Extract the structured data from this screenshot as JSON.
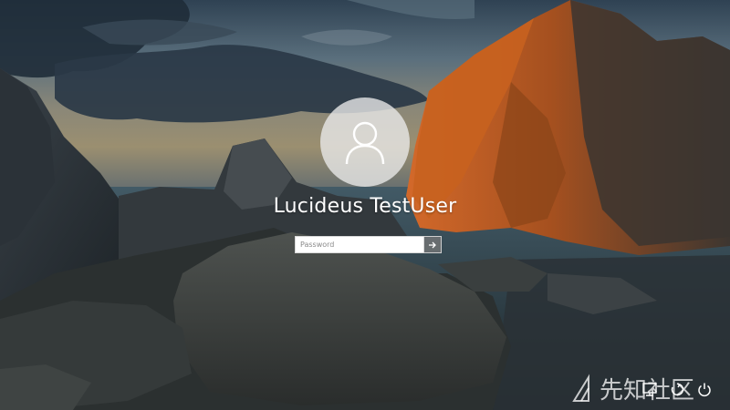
{
  "login": {
    "user_name": "Lucideus TestUser",
    "password_placeholder": "Password",
    "password_value": "",
    "submit_icon": "arrow-right-icon",
    "avatar_icon": "user-silhouette-icon"
  },
  "bottom_bar": {
    "icons": [
      "network-icon",
      "ease-of-access-icon",
      "power-icon"
    ]
  },
  "watermark": {
    "text": "先知社区",
    "icon": "watermark-logo-icon"
  },
  "colors": {
    "text": "#ffffff",
    "avatar_bg": "#ebebeb",
    "input_bg": "#ffffff",
    "submit_bg": "#787878",
    "rock_orange": "#b85a22"
  }
}
